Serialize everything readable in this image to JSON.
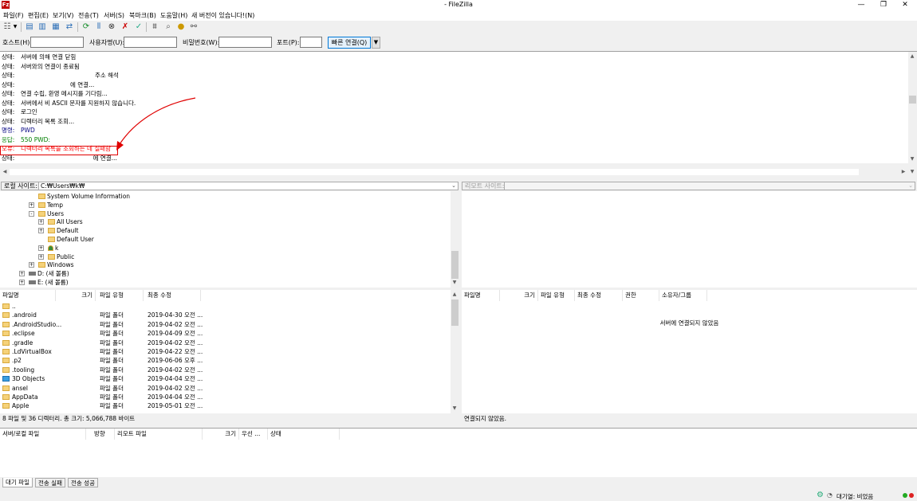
{
  "window": {
    "title": "- FileZilla",
    "app_icon": "Fz"
  },
  "menu": [
    "파일(F)",
    "편집(E)",
    "보기(V)",
    "전송(T)",
    "서버(S)",
    "북마크(B)",
    "도움말(H)",
    "새 버전이 있습니다!(N)"
  ],
  "quickconnect": {
    "host_label": "호스트(H):",
    "user_label": "사용자명(U):",
    "pass_label": "비밀번호(W):",
    "port_label": "포트(P):",
    "connect_label": "빠른 연결(Q)",
    "dropdown_arrow": "▼"
  },
  "log": [
    {
      "key": "상태:",
      "text": "서버에 의해 연결 닫힘",
      "color": "#000000"
    },
    {
      "key": "상태:",
      "text": "서버와의 연결이 종료됨",
      "color": "#000000"
    },
    {
      "key": "상태:",
      "text": "                                       주소 해석",
      "color": "#000000"
    },
    {
      "key": "상태:",
      "text": "                          에 연결...",
      "color": "#000000"
    },
    {
      "key": "상태:",
      "text": "연결 수립, 환영 메시지를 기다림...",
      "color": "#000000"
    },
    {
      "key": "상태:",
      "text": "서버에서 비 ASCII 문자를 지원하지 않습니다.",
      "color": "#000000"
    },
    {
      "key": "상태:",
      "text": "로그인",
      "color": "#000000"
    },
    {
      "key": "상태:",
      "text": "디렉터리 목록 조회...",
      "color": "#000000"
    },
    {
      "key": "명령:",
      "text": "PWD",
      "color": "#000080"
    },
    {
      "key": "응답:",
      "text": "550 PWD:",
      "color": "#008000"
    },
    {
      "key": "오류:",
      "text": "디렉터리 목록을 조회하는 데 실패함",
      "color": "#ff0000"
    },
    {
      "key": "상태:",
      "text": "                                      에 연결...",
      "color": "#000000"
    }
  ],
  "local": {
    "site_label": "로컬 사이트:",
    "path": "C:₩Users₩k₩",
    "tree": [
      {
        "label": "System Volume Information",
        "indent": 3,
        "expander": "",
        "kind": "folder"
      },
      {
        "label": "Temp",
        "indent": 3,
        "expander": "+",
        "kind": "folder"
      },
      {
        "label": "Users",
        "indent": 3,
        "expander": "-",
        "kind": "folder"
      },
      {
        "label": "All Users",
        "indent": 4,
        "expander": "+",
        "kind": "folder"
      },
      {
        "label": "Default",
        "indent": 4,
        "expander": "+",
        "kind": "folder"
      },
      {
        "label": "Default User",
        "indent": 4,
        "expander": "",
        "kind": "folder"
      },
      {
        "label": "k",
        "indent": 4,
        "expander": "+",
        "kind": "user"
      },
      {
        "label": "Public",
        "indent": 4,
        "expander": "+",
        "kind": "folder"
      },
      {
        "label": "Windows",
        "indent": 3,
        "expander": "+",
        "kind": "folder"
      },
      {
        "label": "D: (새 볼륨)",
        "indent": 2,
        "expander": "+",
        "kind": "drive"
      },
      {
        "label": "E: (새 볼륨)",
        "indent": 2,
        "expander": "+",
        "kind": "drive"
      }
    ],
    "columns": [
      "파일명",
      "크기",
      "파일 유형",
      "최종 수정"
    ],
    "files": [
      {
        "name": "..",
        "size": "",
        "type": "",
        "modified": ""
      },
      {
        "name": ".android",
        "size": "",
        "type": "파일 폴더",
        "modified": "2019-04-30 오전 ..."
      },
      {
        "name": ".AndroidStudio...",
        "size": "",
        "type": "파일 폴더",
        "modified": "2019-04-02 오전 ..."
      },
      {
        "name": ".eclipse",
        "size": "",
        "type": "파일 폴더",
        "modified": "2019-04-09 오전 ..."
      },
      {
        "name": ".gradle",
        "size": "",
        "type": "파일 폴더",
        "modified": "2019-04-02 오전 ..."
      },
      {
        "name": ".LdVirtualBox",
        "size": "",
        "type": "파일 폴더",
        "modified": "2019-04-22 오전 ..."
      },
      {
        "name": ".p2",
        "size": "",
        "type": "파일 폴더",
        "modified": "2019-06-06 오후 ..."
      },
      {
        "name": ".tooling",
        "size": "",
        "type": "파일 폴더",
        "modified": "2019-04-02 오전 ..."
      },
      {
        "name": "3D Objects",
        "size": "",
        "type": "파일 폴더",
        "modified": "2019-04-04 오전 ..."
      },
      {
        "name": "ansel",
        "size": "",
        "type": "파일 폴더",
        "modified": "2019-04-02 오전 ..."
      },
      {
        "name": "AppData",
        "size": "",
        "type": "파일 폴더",
        "modified": "2019-04-04 오전 ..."
      },
      {
        "name": "Apple",
        "size": "",
        "type": "파일 폴더",
        "modified": "2019-05-01 오전 ..."
      }
    ],
    "status": "8 파일 및 36 디렉터리. 총 크기: 5,066,788 바이트"
  },
  "remote": {
    "site_label": "리모트 사이트:",
    "path": "",
    "columns": [
      "파일명",
      "크기",
      "파일 유형",
      "최종 수정",
      "권한",
      "소유자/그룹"
    ],
    "empty_message": "서버에 연결되지 않았음",
    "status": "연결되지 않았음."
  },
  "queue": {
    "columns": [
      "서버/로컬 파일",
      "방향",
      "리모트 파일",
      "크기",
      "우선 ...",
      "상태"
    ],
    "tabs": [
      "대기 파일",
      "전송 실패",
      "전송 성공"
    ]
  },
  "statusbar": {
    "queue_text": "대기열: 비었음"
  },
  "colors": {
    "error": "#ff0000",
    "command": "#000080",
    "response": "#008000",
    "highlight_box": "#e00000"
  }
}
